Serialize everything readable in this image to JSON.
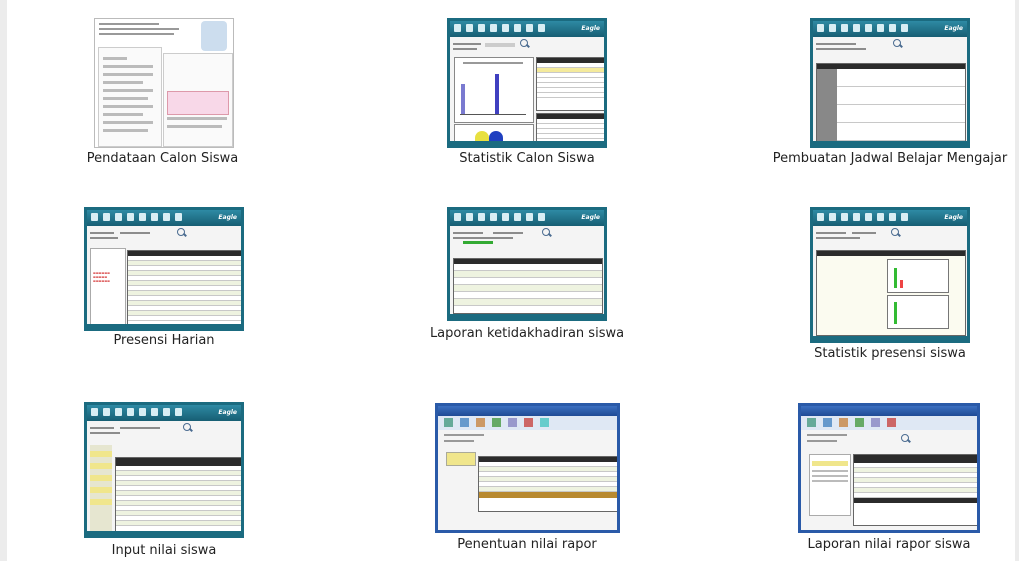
{
  "gallery": {
    "items": [
      {
        "caption": "Pendataan Calon Siswa"
      },
      {
        "caption": "Statistik Calon Siswa"
      },
      {
        "caption": "Pembuatan Jadwal Belajar Mengajar"
      },
      {
        "caption": "Presensi Harian"
      },
      {
        "caption": "Laporan ketidakhadiran siswa"
      },
      {
        "caption": "Statistik presensi siswa"
      },
      {
        "caption": "Input nilai siswa"
      },
      {
        "caption": "Penentuan nilai rapor"
      },
      {
        "caption": "Laporan nilai rapor siswa"
      }
    ]
  },
  "colors": {
    "window_border": "#1b6b80",
    "window_border_alt": "#2a5aa8",
    "header_dark": "#2b2b2b",
    "highlight_yellow": "#f0e68c"
  }
}
